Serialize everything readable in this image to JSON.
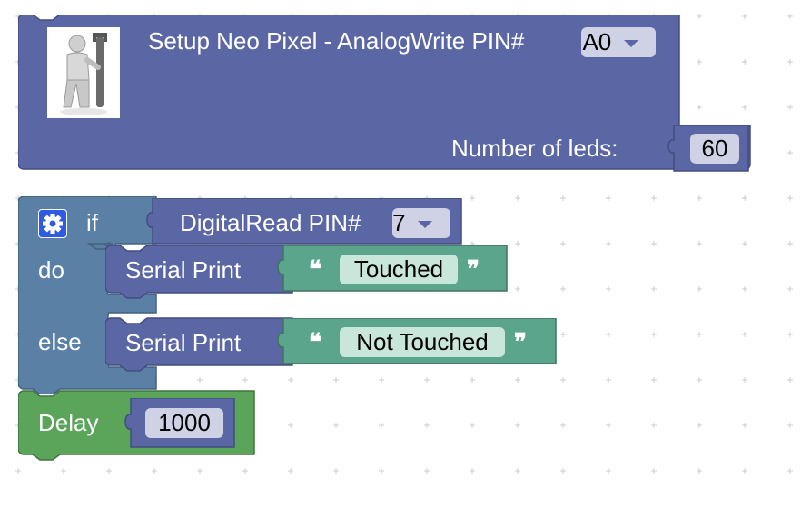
{
  "workspace": {
    "setup_block": {
      "title": "Setup Neo Pixel - AnalogWrite PIN#",
      "pin_value": "A0",
      "leds_label": "Number of leds:",
      "leds_value": "60",
      "icon": "man-with-wrench-icon"
    },
    "if_block": {
      "if_label": "if",
      "do_label": "do",
      "else_label": "else",
      "gear_icon": "gear-icon",
      "condition": {
        "label": "DigitalRead PIN#",
        "pin_value": "7"
      },
      "do_statement": {
        "label": "Serial Print",
        "text": "Touched"
      },
      "else_statement": {
        "label": "Serial Print",
        "text": "Not Touched"
      }
    },
    "delay_block": {
      "label": "Delay",
      "value": "1000"
    },
    "colors": {
      "setup": "#5b67a5",
      "logic": "#5b80a5",
      "text": "#5ba58c",
      "delay": "#5ba55b"
    }
  }
}
